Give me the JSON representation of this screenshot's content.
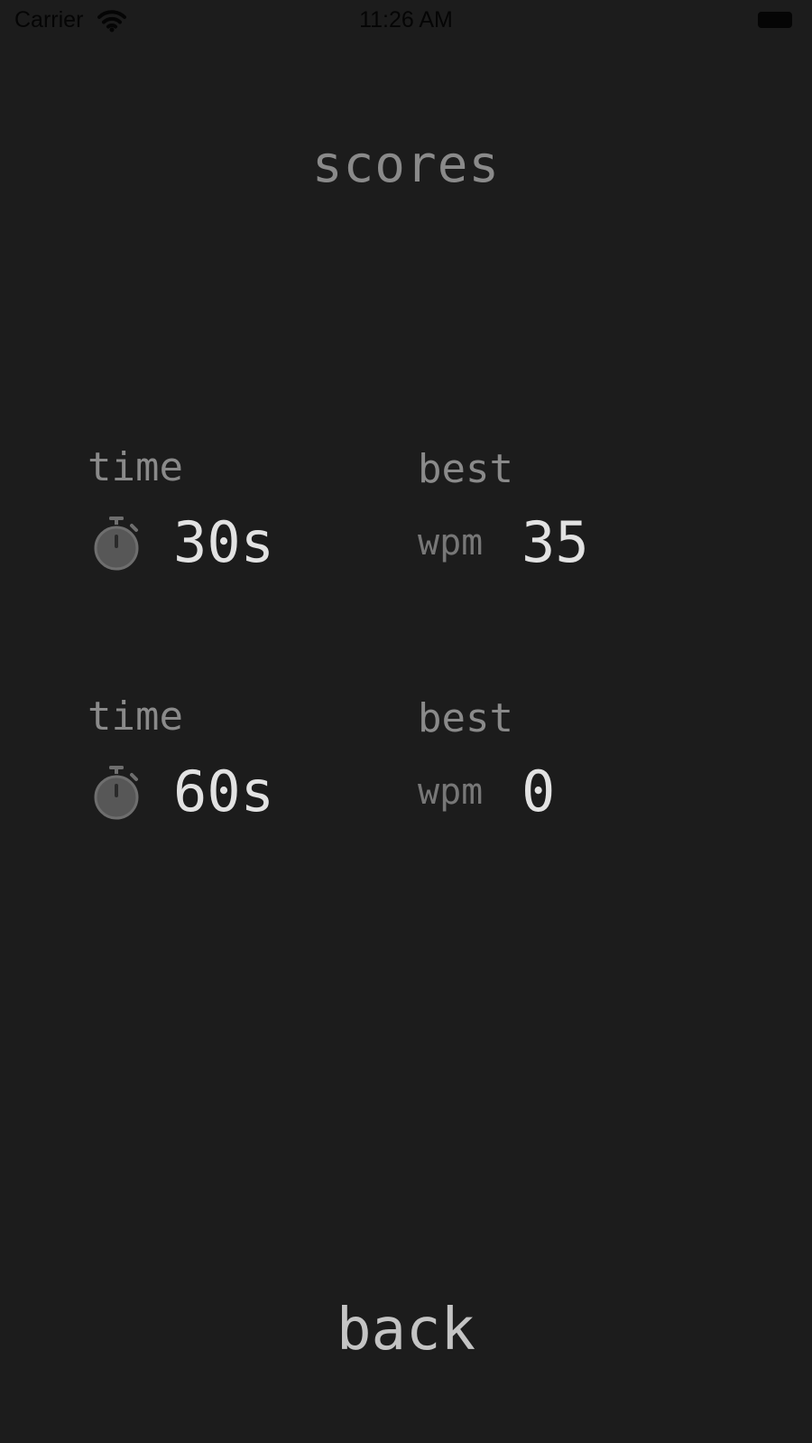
{
  "status_bar": {
    "carrier": "Carrier",
    "time": "11:26 AM"
  },
  "header": {
    "title": "scores"
  },
  "scores": [
    {
      "time_label": "time",
      "time_value": "30s",
      "best_label": "best",
      "wpm_label": "wpm",
      "wpm_value": "35",
      "icon": "stopwatch-icon"
    },
    {
      "time_label": "time",
      "time_value": "60s",
      "best_label": "best",
      "wpm_label": "wpm",
      "wpm_value": "0",
      "icon": "stopwatch-icon"
    }
  ],
  "footer": {
    "back_label": "back"
  },
  "colors": {
    "background": "#1c1c1c",
    "label": "#8a8a8a",
    "value": "#e2e2e2",
    "icon": "#6e6e6e",
    "status_text": "#050505"
  }
}
